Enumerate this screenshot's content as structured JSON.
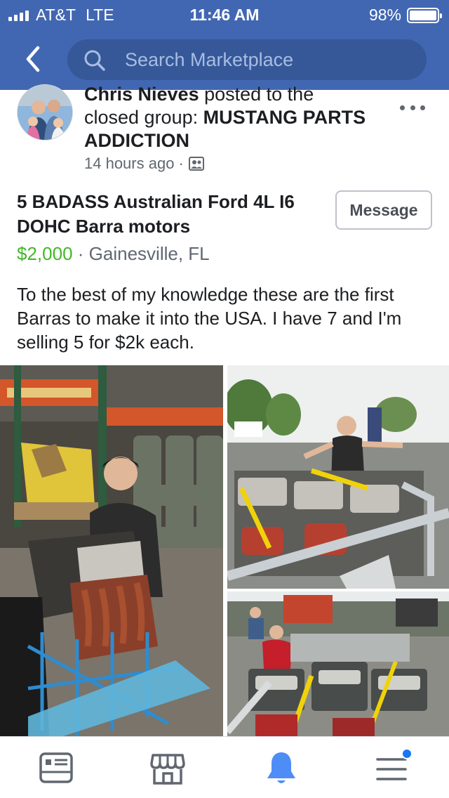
{
  "status_bar": {
    "carrier": "AT&T",
    "network": "LTE",
    "time": "11:46 AM",
    "battery": "98%"
  },
  "search": {
    "placeholder": "Search Marketplace"
  },
  "post": {
    "author": "Chris Nieves",
    "action_text": " posted to the",
    "group_prefix": "closed group: ",
    "group_name_line1": "MUSTANG PARTS",
    "group_name_line2": "ADDICTION",
    "time_ago": "14 hours ago",
    "separator": "·"
  },
  "listing": {
    "title": "5 BADASS Australian Ford 4L I6 DOHC Barra motors",
    "price": "$2,000",
    "separator": "·",
    "location": "Gainesville, FL",
    "message_button": "Message",
    "description": "To the best of my knowledge these are the first Barras to make it into the USA. I have 7 and I'm selling 5 for $2k each."
  },
  "tabs": [
    "news-feed",
    "marketplace",
    "notifications",
    "menu"
  ],
  "colors": {
    "header": "#4267b2",
    "search_bg": "#365899",
    "price": "#42b72a",
    "active_tab": "#4e8df5",
    "notification_dot": "#1877f2"
  }
}
